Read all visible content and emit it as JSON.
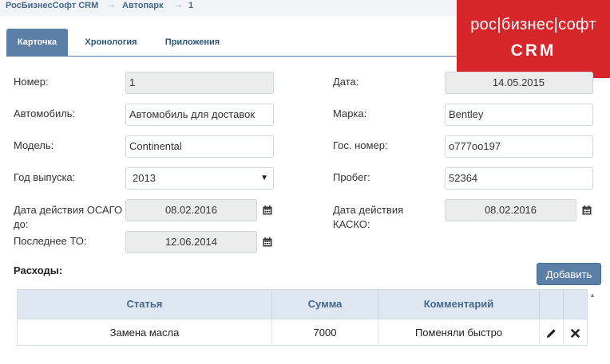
{
  "breadcrumb": {
    "app": "РосБизнесСофт CRM",
    "section": "Автопарк",
    "record": "1",
    "separator": "→"
  },
  "logo": {
    "line1": "рос|бизнес|софт",
    "line2": "CRM"
  },
  "tabs": [
    {
      "label": "Карточка",
      "active": true
    },
    {
      "label": "Хронология",
      "active": false
    },
    {
      "label": "Приложения",
      "active": false
    }
  ],
  "form": {
    "number": {
      "label": "Номер:",
      "value": "1"
    },
    "date": {
      "label": "Дата:",
      "value": "14.05.2015"
    },
    "car": {
      "label": "Автомобиль:",
      "value": "Автомобиль для доставок"
    },
    "brand": {
      "label": "Марка:",
      "value": "Bentley"
    },
    "model": {
      "label": "Модель:",
      "value": "Continental"
    },
    "plate": {
      "label": "Гос. номер:",
      "value": "о777оо197"
    },
    "year": {
      "label": "Год выпуска:",
      "value": "2013"
    },
    "mileage": {
      "label": "Пробег:",
      "value": "52364"
    },
    "osago": {
      "label_line1": "Дата действия ОСАГО",
      "label_line2": "до:",
      "value": "08.02.2016"
    },
    "kasko": {
      "label_line1": "Дата действия",
      "label_line2": "КАСКО:",
      "value": "08.02.2016"
    },
    "last_service": {
      "label": "Последнее ТО:",
      "value": "12.06.2014"
    }
  },
  "expenses": {
    "title": "Расходы:",
    "add_label": "Добавить",
    "columns": [
      "Статья",
      "Сумма",
      "Комментарий"
    ],
    "rows": [
      {
        "item": "Замена масла",
        "amount": "7000",
        "comment": "Поменяли быстро"
      }
    ]
  },
  "colors": {
    "accent": "#5b7fa6",
    "brand_red": "#d6262b",
    "header_bg": "#dfe8f2"
  },
  "icons": [
    "calendar-icon",
    "pencil-icon",
    "delete-icon",
    "dropdown-arrow-icon"
  ]
}
